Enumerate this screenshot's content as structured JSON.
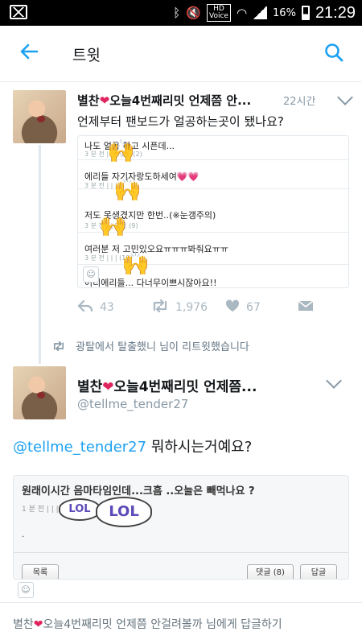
{
  "status_bar": {
    "time": "21:29",
    "battery": "16%",
    "hd_label": "HD",
    "voice_label": "Voice"
  },
  "app_bar": {
    "title": "트윗"
  },
  "tweet1": {
    "author_name": "별찬❤오늘4번째리밋 언제쯤 안...",
    "time": "22시간",
    "text": "언제부터 팬보드가 얼공하는곳이 됐나요?",
    "media_rows": [
      {
        "title": "나도 얼공 하고 시픈데...",
        "meta": "3 분 전 |  |  | 댓글 (2)"
      },
      {
        "title": "에리들 자기자랑도하세여💗💗",
        "meta": "3 분 전 |  |  |"
      },
      {
        "title": "저도 못생겼지만 한번..(※눈갱주의)",
        "meta": "3 분 전 |  | 댓글 (9)"
      },
      {
        "title": "여러분 저 고민있오요ㅠㅠㅠ봐줘요ㅠㅠ",
        "meta": "3 분 전 |  |  | (19)"
      },
      {
        "title": "어디에리들... 다너무이쁘시잖아요!!",
        "meta": ""
      }
    ],
    "reply_count": "43",
    "retweet_count": "1,976",
    "like_count": "67"
  },
  "retweet_notice": "광탈에서 탈출했니 님이 리트윗했습니다",
  "tweet2": {
    "author_name": "별찬❤오늘4번째리밋 언제쯤...",
    "handle": "@tellme_tender27",
    "mention": "@tellme_tender27",
    "text": " 뭐하시는거예요?",
    "card": {
      "title": "원래이시간 음마타임인데...크흠 ..오늘은 빼먹나요 ?",
      "meta": "1 분 전 |  |  | 댓글 (8)",
      "dot": ".",
      "btn_list": "목록",
      "btn_comment": "댓글 (8)",
      "btn_reply": "답글",
      "sticker_text": "LOL"
    }
  },
  "reply_prompt": "별찬❤오늘4번째리밋 언제쯤 안걸려볼까 님에게 답글하기",
  "colors": {
    "accent": "#1da1f2",
    "heart": "#e0245e",
    "muted": "#8899a6"
  }
}
